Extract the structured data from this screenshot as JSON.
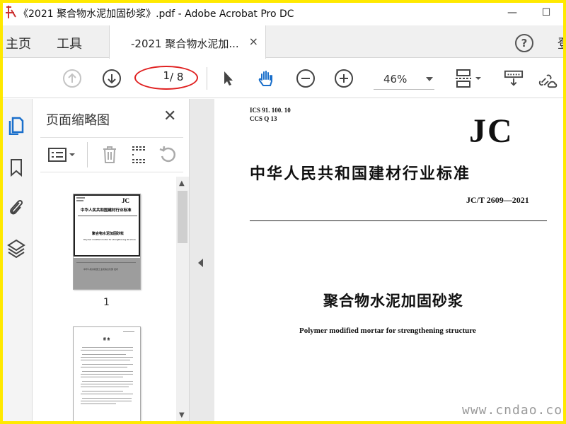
{
  "window": {
    "title": "《2021 聚合物水泥加固砂浆》.pdf - Adobe Acrobat Pro DC",
    "logo_text": "道刀网",
    "minimize": "—",
    "maximize": "☐"
  },
  "tabs": {
    "home": "主页",
    "tools": "工具",
    "doc_tab_label": "-2021 聚合物水泥加...",
    "doc_tab_close": "×",
    "help": "?",
    "partial_right": "登"
  },
  "toolbar": {
    "page_current": "1",
    "page_total": "/ 8",
    "zoom": "46%",
    "highlight_color": "#e02020"
  },
  "panel": {
    "title": "页面缩略图",
    "close": "✕",
    "thumbnails": [
      {
        "page_label": "1"
      },
      {
        "page_label": ""
      }
    ]
  },
  "thumb1": {
    "jc": "JC",
    "org": "中华人民共和国建材行业标准",
    "title_cn": "聚合物水泥加固砂浆",
    "title_en": "Polymer modified mortar for strengthening structure",
    "footer": "中华人民共和国工业和信息化部 发布"
  },
  "thumb2": {
    "heading": "前 言"
  },
  "document": {
    "ics": "ICS 91. 100. 10",
    "ccs": "CCS Q 13",
    "jc": "JC",
    "org": "中华人民共和国建材行业标准",
    "standard_no": "JC/T 2609—2021",
    "title_cn": "聚合物水泥加固砂浆",
    "title_en": "Polymer modified mortar for strengthening structure"
  },
  "watermark": "www.cndao.com",
  "colors": {
    "frame": "#ffe900",
    "accent_blue": "#1a6fcb"
  }
}
